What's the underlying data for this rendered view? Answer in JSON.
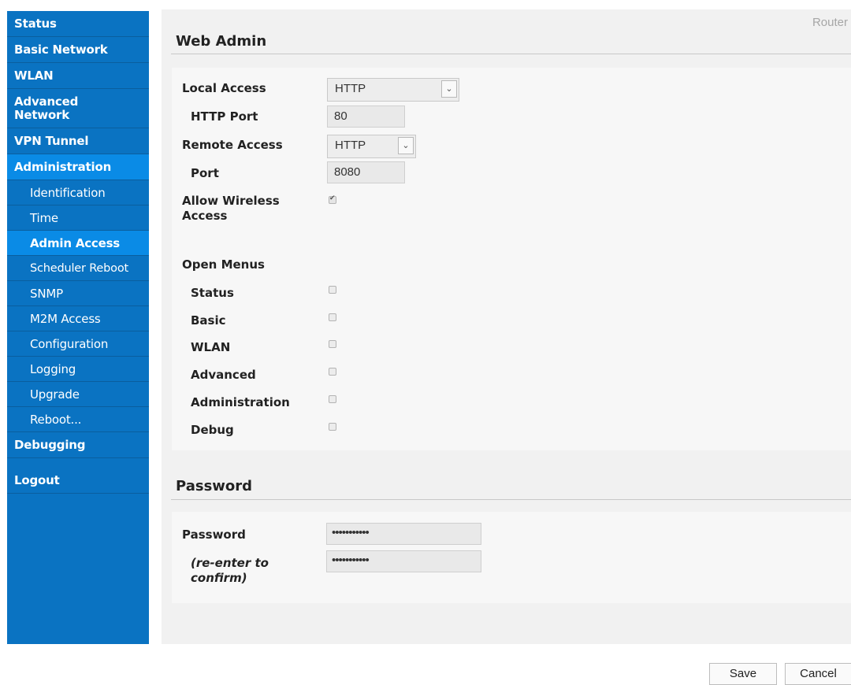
{
  "sidebar": {
    "items": [
      {
        "label": "Status"
      },
      {
        "label": "Basic Network"
      },
      {
        "label": "WLAN"
      },
      {
        "label": "Advanced Network"
      },
      {
        "label": "VPN Tunnel"
      },
      {
        "label": "Administration"
      }
    ],
    "subitems": [
      {
        "label": "Identification"
      },
      {
        "label": "Time"
      },
      {
        "label": "Admin Access"
      },
      {
        "label": "Scheduler Reboot"
      },
      {
        "label": "SNMP"
      },
      {
        "label": "M2M Access"
      },
      {
        "label": "Configuration"
      },
      {
        "label": "Logging"
      },
      {
        "label": "Upgrade"
      },
      {
        "label": "Reboot..."
      }
    ],
    "debugging": "Debugging",
    "logout": "Logout"
  },
  "header": {
    "router_label": "Router"
  },
  "web_admin": {
    "title": "Web Admin",
    "local_access_label": "Local Access",
    "local_access_value": "HTTP",
    "http_port_label": "HTTP Port",
    "http_port_value": "80",
    "remote_access_label": "Remote Access",
    "remote_access_value": "HTTP",
    "port_label": "Port",
    "port_value": "8080",
    "allow_wireless_label": "Allow Wireless Access",
    "allow_wireless_checked": true,
    "open_menus_label": "Open Menus",
    "menus": [
      {
        "label": "Status",
        "checked": false
      },
      {
        "label": "Basic",
        "checked": false
      },
      {
        "label": "WLAN",
        "checked": false
      },
      {
        "label": "Advanced",
        "checked": false
      },
      {
        "label": "Administration",
        "checked": false
      },
      {
        "label": "Debug",
        "checked": false
      }
    ]
  },
  "password": {
    "title": "Password",
    "password_label": "Password",
    "password_value": "•••••••••••",
    "confirm_label": "(re-enter to confirm)",
    "confirm_value": "•••••••••••"
  },
  "buttons": {
    "save": "Save",
    "cancel": "Cancel"
  },
  "icons": {
    "dropdown": "chevron-down-icon",
    "checkmark": "checkmark-icon"
  },
  "colors": {
    "sidebar": "#0a73c2",
    "sidebar_active": "#0a8be6",
    "main_bg": "#f1f1f1"
  }
}
